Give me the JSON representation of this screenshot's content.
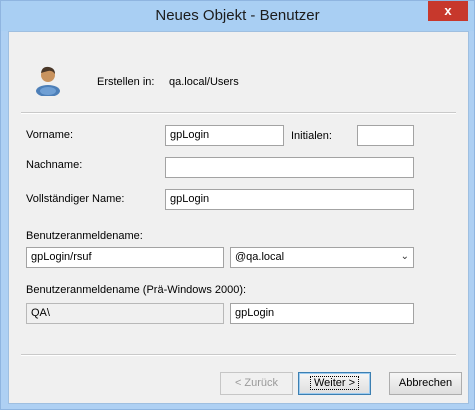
{
  "window": {
    "title": "Neues Objekt - Benutzer",
    "close_glyph": "x"
  },
  "header": {
    "create_in_label": "Erstellen in:",
    "create_in_value": "qa.local/Users",
    "icon": "user-icon"
  },
  "form": {
    "firstname_label": "Vorname:",
    "firstname_value": "gpLogin",
    "initials_label": "Initialen:",
    "initials_value": "",
    "lastname_label": "Nachname:",
    "lastname_value": "",
    "fullname_label": "Vollständiger Name:",
    "fullname_value": "gpLogin",
    "logon_label": "Benutzeranmeldename:",
    "logon_value": "gpLogin/rsuf",
    "domain_value": "@qa.local",
    "prewin_label": "Benutzeranmeldename (Prä-Windows 2000):",
    "prewin_domain": "QA\\",
    "prewin_value": "gpLogin"
  },
  "buttons": {
    "back": "< Zurück",
    "next": "Weiter >",
    "cancel": "Abbrechen"
  }
}
